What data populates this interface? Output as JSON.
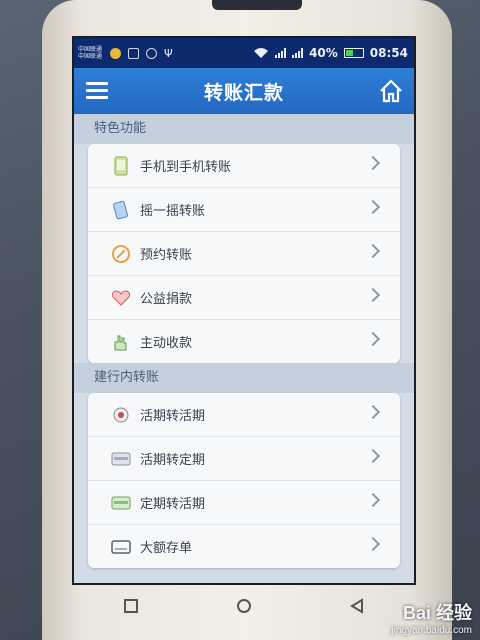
{
  "statusbar": {
    "carrier_line1": "中国联通",
    "carrier_line2": "中国联通",
    "battery_percent": "40%",
    "battery_level": 0.4,
    "time": "08:54"
  },
  "header": {
    "title": "转账汇款",
    "menu_icon": "hamburger-menu-icon",
    "home_icon": "home-icon"
  },
  "sections": [
    {
      "title": "特色功能",
      "items": [
        {
          "label": "手机到手机转账",
          "icon": "phone-transfer-icon"
        },
        {
          "label": "摇一摇转账",
          "icon": "shake-phone-icon"
        },
        {
          "label": "预约转账",
          "icon": "schedule-icon"
        },
        {
          "label": "公益捐款",
          "icon": "heart-donation-icon"
        },
        {
          "label": "主动收款",
          "icon": "hand-collect-icon"
        }
      ]
    },
    {
      "title": "建行内转账",
      "items": [
        {
          "label": "活期转活期",
          "icon": "current-account-icon"
        },
        {
          "label": "活期转定期",
          "icon": "card-icon"
        },
        {
          "label": "定期转活期",
          "icon": "card-green-icon"
        },
        {
          "label": "大额存单",
          "icon": "deposit-card-icon"
        }
      ]
    }
  ],
  "watermark": {
    "main": "Bai 经验",
    "sub": "jingyan.baidu.com"
  },
  "colors": {
    "statusbar": "#0d2a6e",
    "header": "#2268c2",
    "section_bg": "#c4d0de"
  }
}
